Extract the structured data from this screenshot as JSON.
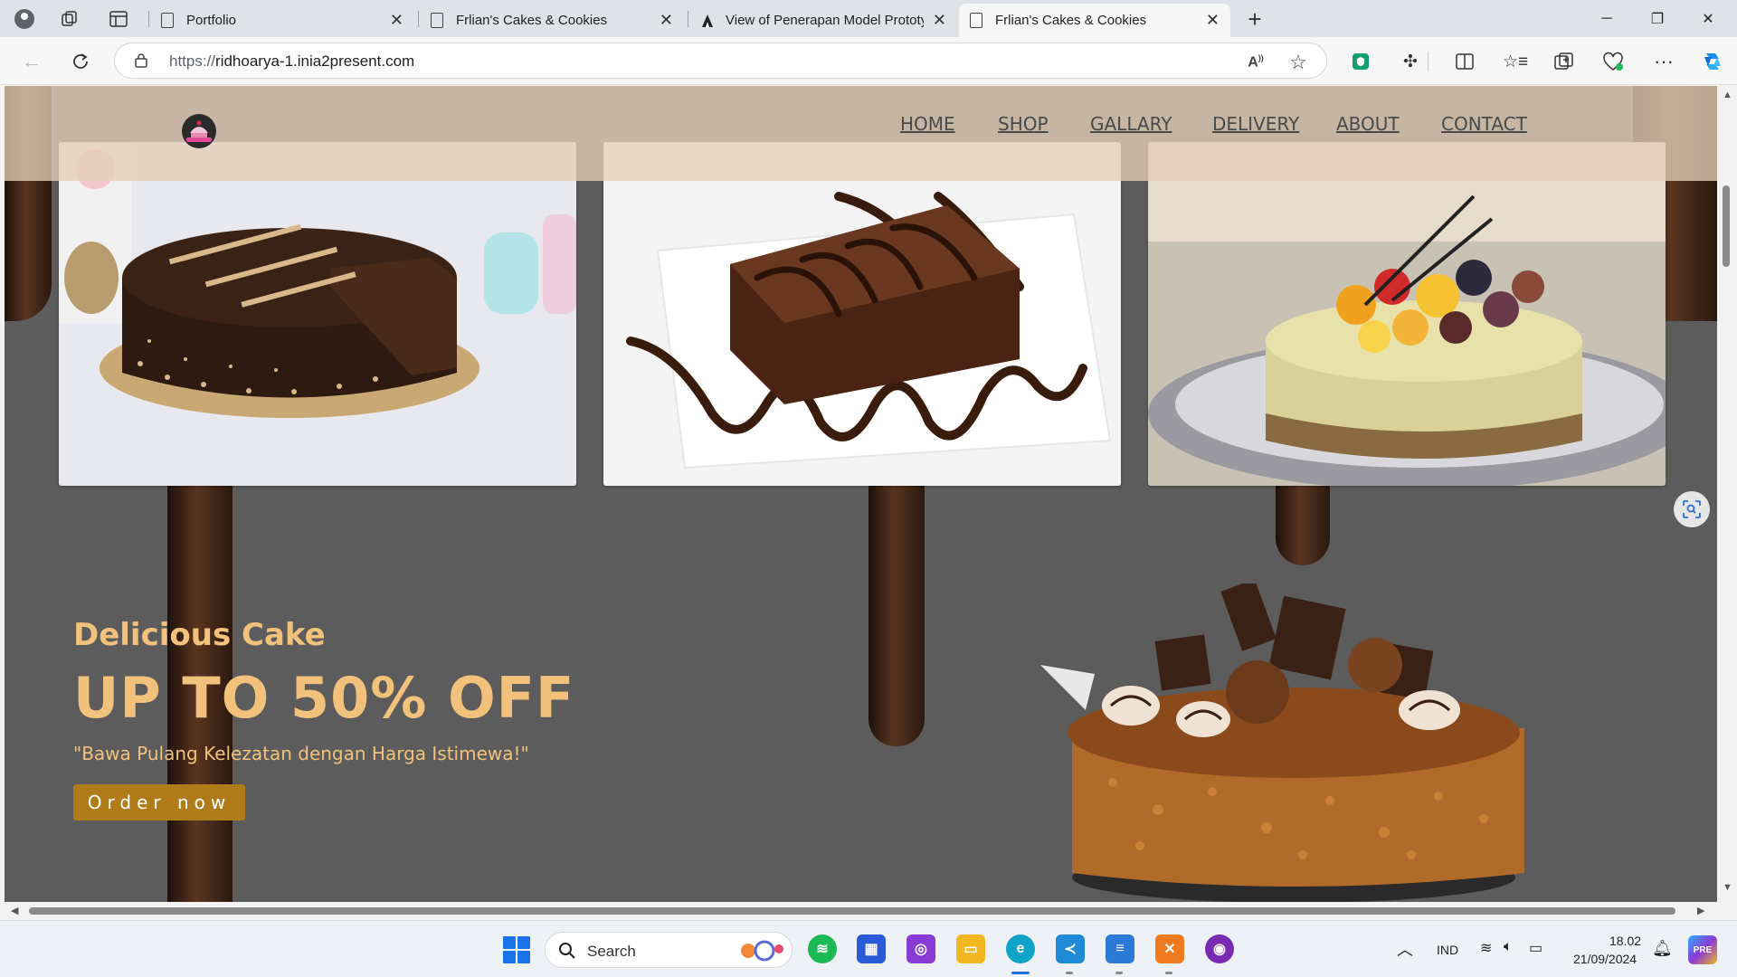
{
  "browser": {
    "tabs": [
      {
        "label": "Portfolio",
        "active": false
      },
      {
        "label": "Frlian's Cakes & Cookies",
        "active": false
      },
      {
        "label": "View of Penerapan Model Prototy",
        "active": false
      },
      {
        "label": "Frlian's Cakes & Cookies",
        "active": true
      }
    ],
    "url_prefix": "https://",
    "url_host": "ridhoarya-1.inia2present.com"
  },
  "site": {
    "nav": [
      "HOME",
      "SHOP",
      "GALLARY",
      "DELIVERY",
      "ABOUT",
      "CONTACT"
    ],
    "hero": {
      "subtitle": "Delicious Cake",
      "title": "UP TO 50% OFF",
      "quote": "\"Bawa Pulang Kelezatan dengan Harga Istimewa!\"",
      "button": "Order now"
    },
    "colors": {
      "accent": "#f2c27c",
      "button": "#b07c1a",
      "navbar": "#e4ceb6",
      "background": "#5c5c5c"
    }
  },
  "taskbar": {
    "search_label": "Search",
    "language": "IND",
    "time": "18.02",
    "date": "21/09/2024"
  }
}
